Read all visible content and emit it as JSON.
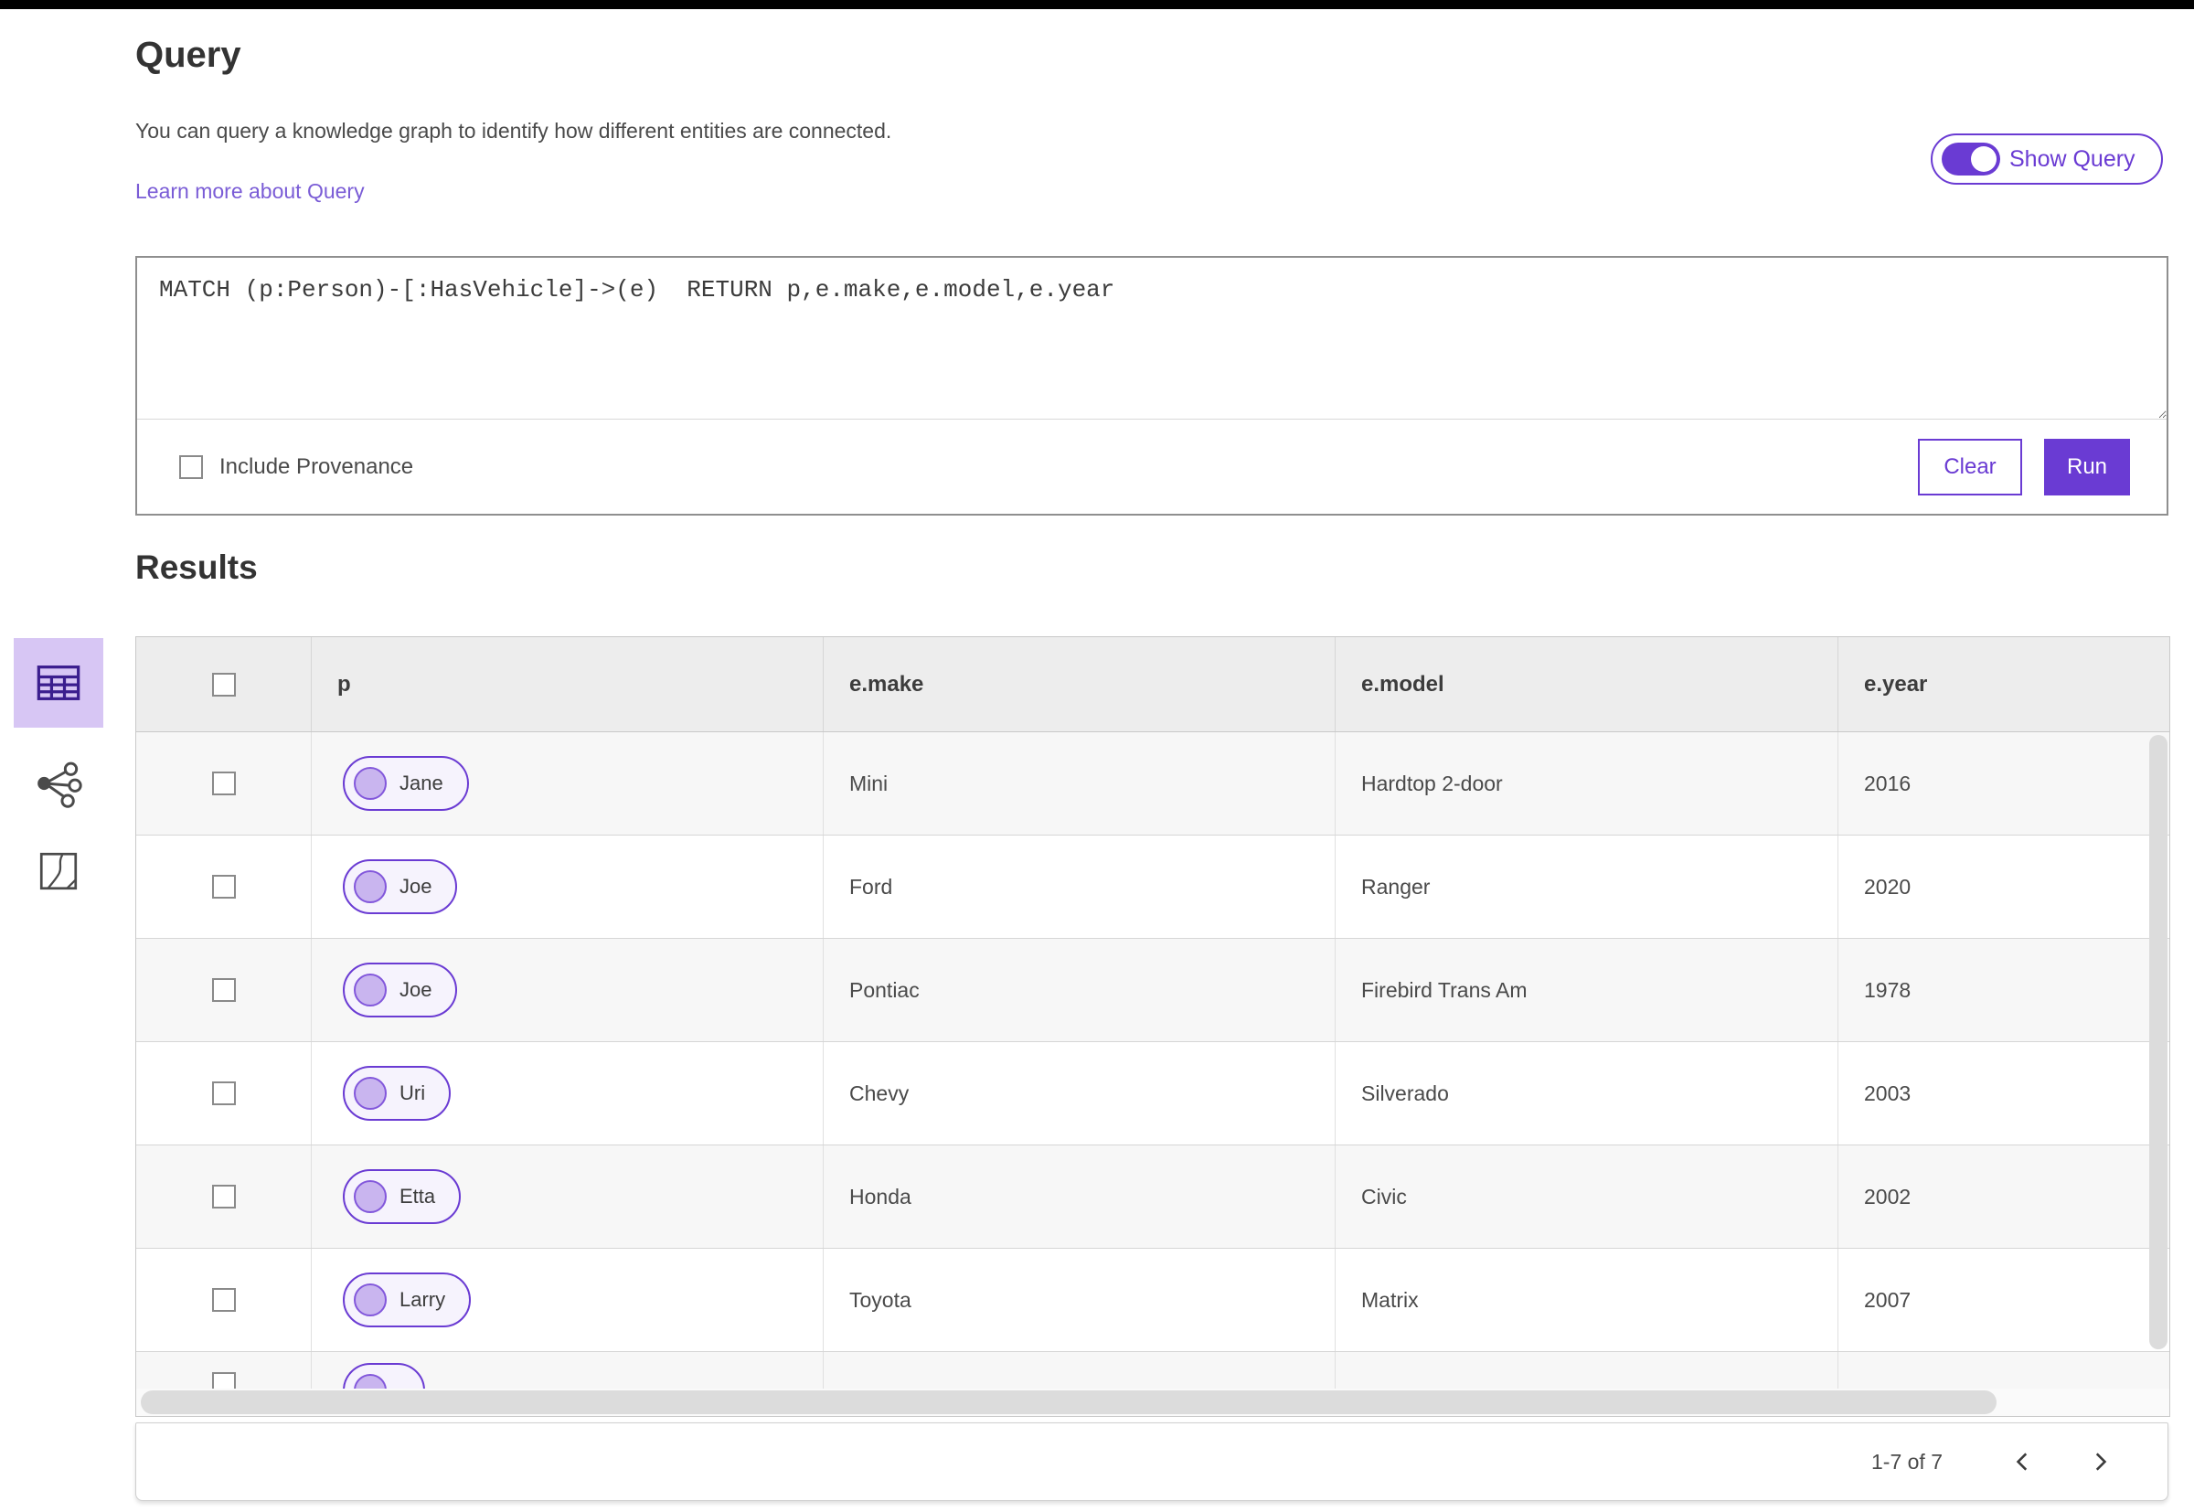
{
  "query_section": {
    "title": "Query",
    "description": "You can query a knowledge graph to identify how different entities are connected.",
    "learn_more_link": "Learn more about Query",
    "show_query_toggle": {
      "label": "Show Query",
      "state": "on"
    },
    "query_text": "MATCH (p:Person)-[:HasVehicle]->(e)  RETURN p,e.make,e.model,e.year",
    "include_provenance": {
      "label": "Include Provenance",
      "checked": false
    },
    "clear_button_label": "Clear",
    "run_button_label": "Run"
  },
  "results_section": {
    "title": "Results",
    "views": [
      {
        "name": "table-view",
        "icon": "table-icon",
        "selected": true
      },
      {
        "name": "link-chart-view",
        "icon": "link-chart-icon",
        "selected": false
      },
      {
        "name": "map-view",
        "icon": "map-icon",
        "selected": false
      }
    ],
    "table": {
      "columns": [
        "p",
        "e.make",
        "e.model",
        "e.year"
      ],
      "rows": [
        {
          "p": "Jane",
          "make": "Mini",
          "model": "Hardtop 2-door",
          "year": "2016"
        },
        {
          "p": "Joe",
          "make": "Ford",
          "model": "Ranger",
          "year": "2020"
        },
        {
          "p": "Joe",
          "make": "Pontiac",
          "model": "Firebird Trans Am",
          "year": "1978"
        },
        {
          "p": "Uri",
          "make": "Chevy",
          "model": "Silverado",
          "year": "2003"
        },
        {
          "p": "Etta",
          "make": "Honda",
          "model": "Civic",
          "year": "2002"
        },
        {
          "p": "Larry",
          "make": "Toyota",
          "model": "Matrix",
          "year": "2007"
        }
      ],
      "partial_row_visible": true
    },
    "pagination": {
      "range_label": "1-7 of 7"
    }
  },
  "colors": {
    "accent_purple": "#6a3bd3",
    "link_purple": "#7a5cd6",
    "selected_view_bg": "#d7c6f4",
    "selected_view_icon": "#3b1e8e",
    "pill_background": "#f6f3fd",
    "pill_node_fill": "#c9b5ef",
    "table_header_bg": "#ededed",
    "row_alt_bg": "#f7f7f7",
    "top_bar": "#000000"
  }
}
